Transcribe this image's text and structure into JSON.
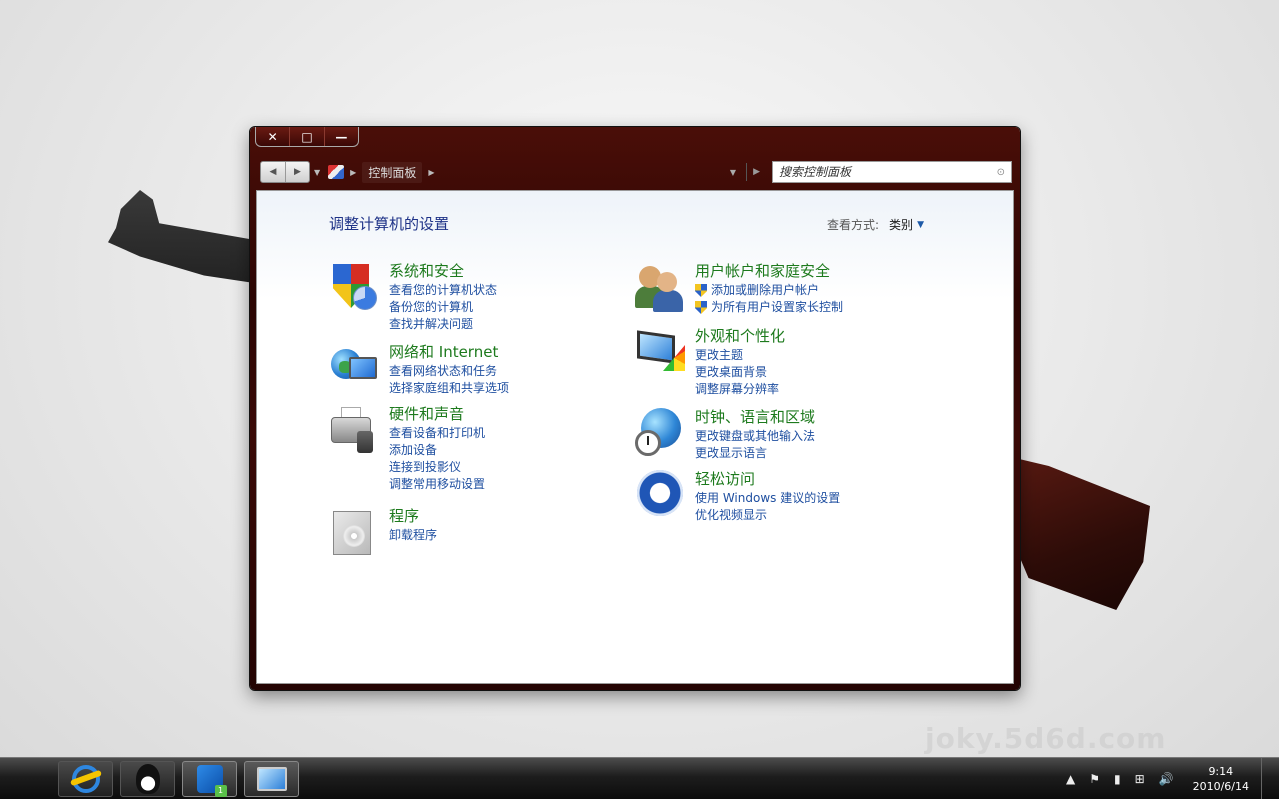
{
  "watermark": "joky.5d6d.com",
  "window": {
    "caption": {
      "close": "✕",
      "maximize": "□",
      "minimize": "—"
    },
    "breadcrumb": [
      "控制面板"
    ],
    "search_placeholder": "搜索控制面板"
  },
  "content": {
    "title": "调整计算机的设置",
    "view_by_label": "查看方式:",
    "view_by_value": "类别"
  },
  "categories_left": [
    {
      "title": "系统和安全",
      "icon": "security-shield-icon",
      "links": [
        "查看您的计算机状态",
        "备份您的计算机",
        "查找并解决问题"
      ]
    },
    {
      "title": "网络和 Internet",
      "icon": "network-globe-icon",
      "links": [
        "查看网络状态和任务",
        "选择家庭组和共享选项"
      ]
    },
    {
      "title": "硬件和声音",
      "icon": "printer-speaker-icon",
      "links": [
        "查看设备和打印机",
        "添加设备",
        "连接到投影仪",
        "调整常用移动设置"
      ]
    },
    {
      "title": "程序",
      "icon": "programs-disc-icon",
      "links": [
        "卸载程序"
      ]
    }
  ],
  "categories_right": [
    {
      "title": "用户帐户和家庭安全",
      "icon": "users-icon",
      "links": [
        "添加或删除用户帐户",
        "为所有用户设置家长控制"
      ]
    },
    {
      "title": "外观和个性化",
      "icon": "monitor-palette-icon",
      "links": [
        "更改主题",
        "更改桌面背景",
        "调整屏幕分辨率"
      ]
    },
    {
      "title": "时钟、语言和区域",
      "icon": "globe-clock-icon",
      "links": [
        "更改键盘或其他输入法",
        "更改显示语言"
      ]
    },
    {
      "title": "轻松访问",
      "icon": "ease-of-access-icon",
      "links": [
        "使用 Windows 建议的设置",
        "优化视频显示"
      ]
    }
  ],
  "taskbar": {
    "start_glyph": "",
    "feiq_badge": "1",
    "clock_time": "9:14",
    "clock_date": "2010/6/14"
  }
}
